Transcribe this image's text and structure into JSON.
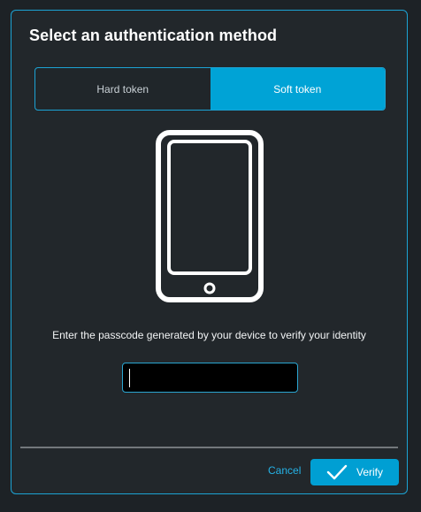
{
  "dialog": {
    "title": "Select an authentication method"
  },
  "methods": {
    "hard_token_label": "Hard token",
    "soft_token_label": "Soft token",
    "selected": "Soft token"
  },
  "illustration": {
    "icon_name": "smartphone-icon"
  },
  "passcode": {
    "instruction": "Enter the passcode generated by your device to verify your identity",
    "value": "",
    "placeholder": ""
  },
  "actions": {
    "cancel_label": "Cancel",
    "verify_label": "Verify",
    "verify_icon_name": "checkmark-icon"
  },
  "colors": {
    "background": "#1d2226",
    "dialog_background": "#22272b",
    "accent": "#00a3d6",
    "text": "#ffffff",
    "divider": "#73787c"
  }
}
